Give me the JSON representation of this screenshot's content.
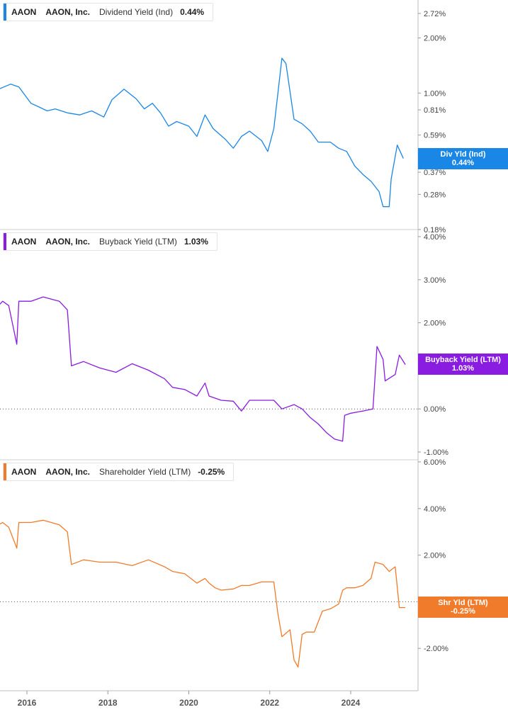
{
  "chart_data": [
    {
      "type": "line",
      "ticker": "AAON",
      "company": "AAON, Inc.",
      "metric_label": "Dividend Yield (Ind)",
      "current_value": "0.44%",
      "flag_label": "Div Yld (Ind)",
      "flag_value": "0.44%",
      "color": "#1a86e6",
      "y_scale": "log",
      "yticks": [
        "2.72%",
        "2.00%",
        "1.00%",
        "0.81%",
        "0.59%",
        "0.44%",
        "0.37%",
        "0.28%",
        "0.18%"
      ],
      "series": [
        {
          "x": [
            2015.0,
            2015.3,
            2015.6,
            2015.8,
            2016.1,
            2016.3,
            2016.5,
            2016.7,
            2017.0,
            2017.3,
            2017.6,
            2017.9,
            2018.1,
            2018.4,
            2018.7,
            2018.9,
            2019.1,
            2019.3,
            2019.5,
            2019.7,
            2020.0,
            2020.2,
            2020.4,
            2020.6,
            2020.9,
            2021.1,
            2021.3,
            2021.5,
            2021.8,
            2021.95,
            2022.1,
            2022.3,
            2022.4,
            2022.6,
            2022.8,
            2023.0,
            2023.2,
            2023.5,
            2023.7,
            2023.9,
            2024.1,
            2024.3,
            2024.5,
            2024.7,
            2024.8,
            2024.95,
            2025.0,
            2025.15,
            2025.3
          ],
          "y": [
            0.78,
            1.05,
            1.12,
            1.08,
            0.88,
            0.84,
            0.8,
            0.82,
            0.78,
            0.76,
            0.8,
            0.74,
            0.92,
            1.05,
            0.93,
            0.82,
            0.88,
            0.78,
            0.66,
            0.7,
            0.66,
            0.58,
            0.76,
            0.64,
            0.56,
            0.5,
            0.58,
            0.62,
            0.55,
            0.48,
            0.64,
            1.55,
            1.45,
            0.72,
            0.68,
            0.62,
            0.54,
            0.54,
            0.5,
            0.48,
            0.4,
            0.36,
            0.33,
            0.29,
            0.24,
            0.24,
            0.34,
            0.52,
            0.44
          ]
        }
      ]
    },
    {
      "type": "line",
      "ticker": "AAON",
      "company": "AAON, Inc.",
      "metric_label": "Buyback Yield (LTM)",
      "current_value": "1.03%",
      "flag_label": "Buyback Yield (LTM)",
      "flag_value": "1.03%",
      "color": "#8a1be0",
      "ylim": [
        -1,
        4
      ],
      "yticks": [
        "4.00%",
        "3.00%",
        "2.00%",
        "0.00%",
        "-1.00%"
      ],
      "series": [
        {
          "x": [
            2015.0,
            2015.4,
            2015.55,
            2015.75,
            2015.8,
            2016.1,
            2016.4,
            2016.8,
            2017.0,
            2017.1,
            2017.4,
            2017.8,
            2018.2,
            2018.6,
            2019.0,
            2019.4,
            2019.6,
            2019.9,
            2020.2,
            2020.4,
            2020.5,
            2020.65,
            2020.8,
            2021.1,
            2021.3,
            2021.5,
            2021.8,
            2022.1,
            2022.3,
            2022.6,
            2022.8,
            2023.0,
            2023.2,
            2023.4,
            2023.6,
            2023.8,
            2023.85,
            2024.0,
            2024.3,
            2024.55,
            2024.65,
            2024.8,
            2024.85,
            2025.1,
            2025.2,
            2025.35
          ],
          "y": [
            2.1,
            2.5,
            2.4,
            1.5,
            2.5,
            2.5,
            2.6,
            2.5,
            2.3,
            1.0,
            1.1,
            0.95,
            0.85,
            1.05,
            0.9,
            0.7,
            0.5,
            0.45,
            0.3,
            0.6,
            0.3,
            0.25,
            0.2,
            0.18,
            -0.05,
            0.2,
            0.2,
            0.2,
            0.0,
            0.1,
            0.0,
            -0.2,
            -0.35,
            -0.55,
            -0.7,
            -0.75,
            -0.15,
            -0.1,
            -0.05,
            0.0,
            1.45,
            1.15,
            0.65,
            0.8,
            1.25,
            1.03
          ]
        }
      ]
    },
    {
      "type": "line",
      "ticker": "AAON",
      "company": "AAON, Inc.",
      "metric_label": "Shareholder Yield (LTM)",
      "current_value": "-0.25%",
      "flag_label": "Shr Yld (LTM)",
      "flag_value": "-0.25%",
      "color": "#f07c2b",
      "ylim": [
        -4,
        6
      ],
      "yticks": [
        "6.00%",
        "4.00%",
        "2.00%",
        "-2.00%"
      ],
      "series": [
        {
          "x": [
            2015.0,
            2015.4,
            2015.55,
            2015.75,
            2015.8,
            2016.1,
            2016.4,
            2016.8,
            2017.0,
            2017.1,
            2017.4,
            2017.8,
            2018.2,
            2018.6,
            2019.0,
            2019.4,
            2019.6,
            2019.9,
            2020.2,
            2020.4,
            2020.5,
            2020.65,
            2020.8,
            2021.1,
            2021.3,
            2021.5,
            2021.8,
            2022.1,
            2022.2,
            2022.3,
            2022.5,
            2022.6,
            2022.7,
            2022.8,
            2022.9,
            2023.1,
            2023.3,
            2023.5,
            2023.7,
            2023.8,
            2023.9,
            2024.1,
            2024.3,
            2024.5,
            2024.6,
            2024.8,
            2024.95,
            2025.1,
            2025.2,
            2025.35
          ],
          "y": [
            3.0,
            3.4,
            3.2,
            2.3,
            3.4,
            3.4,
            3.5,
            3.3,
            3.0,
            1.6,
            1.8,
            1.7,
            1.7,
            1.55,
            1.8,
            1.5,
            1.3,
            1.2,
            0.8,
            1.0,
            0.8,
            0.6,
            0.5,
            0.55,
            0.7,
            0.7,
            0.85,
            0.85,
            -0.5,
            -1.5,
            -1.2,
            -2.5,
            -2.8,
            -1.4,
            -1.3,
            -1.3,
            -0.4,
            -0.3,
            -0.1,
            0.5,
            0.6,
            0.6,
            0.7,
            1.0,
            1.7,
            1.6,
            1.3,
            1.5,
            -0.25,
            -0.25
          ]
        }
      ]
    }
  ],
  "x_axis": {
    "ticks": [
      "2016",
      "2018",
      "2020",
      "2022",
      "2024"
    ],
    "values": [
      2016,
      2018,
      2020,
      2022,
      2024
    ],
    "range": [
      2015.0,
      2025.5
    ]
  }
}
